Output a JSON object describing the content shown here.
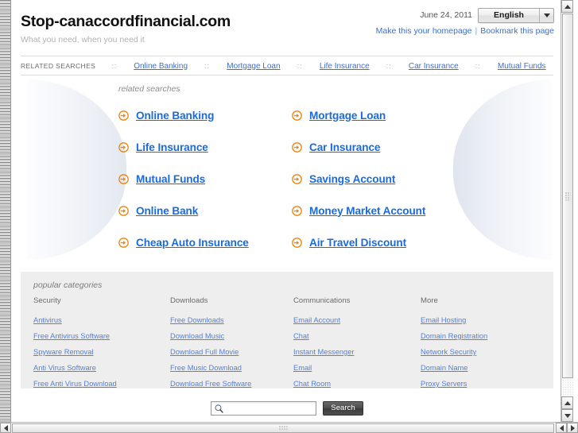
{
  "header": {
    "site_title": "Stop-canaccordfinancial.com",
    "tagline": "What you need, when you need it",
    "date": "June 24, 2011",
    "language_selected": "English",
    "make_homepage": "Make this your homepage",
    "bookmark": "Bookmark this page"
  },
  "related_bar": {
    "label": "RELATED SEARCHES",
    "items": [
      "Online Banking",
      "Mortgage Loan",
      "Life Insurance",
      "Car Insurance",
      "Mutual Funds"
    ]
  },
  "main": {
    "heading": "related searches",
    "links": [
      "Online Banking",
      "Mortgage Loan",
      "Life Insurance",
      "Car Insurance",
      "Mutual Funds",
      "Savings Account",
      "Online Bank",
      "Money Market Account",
      "Cheap Auto Insurance",
      "Air Travel Discount"
    ]
  },
  "popular": {
    "heading": "popular categories",
    "columns": [
      {
        "title": "Security",
        "links": [
          "Antivirus",
          "Free Antivirus Software",
          "Spyware Removal",
          "Anti Virus Software",
          "Free Anti Virus Download"
        ]
      },
      {
        "title": "Downloads",
        "links": [
          "Free Downloads",
          "Download Music",
          "Download Full Movie",
          "Free Music Download",
          "Download Free Software"
        ]
      },
      {
        "title": "Communications",
        "links": [
          "Email Account",
          "Chat",
          "Instant Messenger",
          "Email",
          "Chat Room"
        ]
      },
      {
        "title": "More",
        "links": [
          "Email Hosting",
          "Domain Registration",
          "Network Security",
          "Domain Name",
          "Proxy Servers"
        ]
      }
    ]
  },
  "search": {
    "value": "",
    "placeholder": "",
    "button_label": "Search"
  },
  "colors": {
    "link_blue": "#3b6fd4",
    "big_link_blue": "#1a6bdb",
    "arrow_orange": "#e8861a",
    "panel_gray": "#eeeeee",
    "tagline_gray": "#b2b2b2"
  }
}
